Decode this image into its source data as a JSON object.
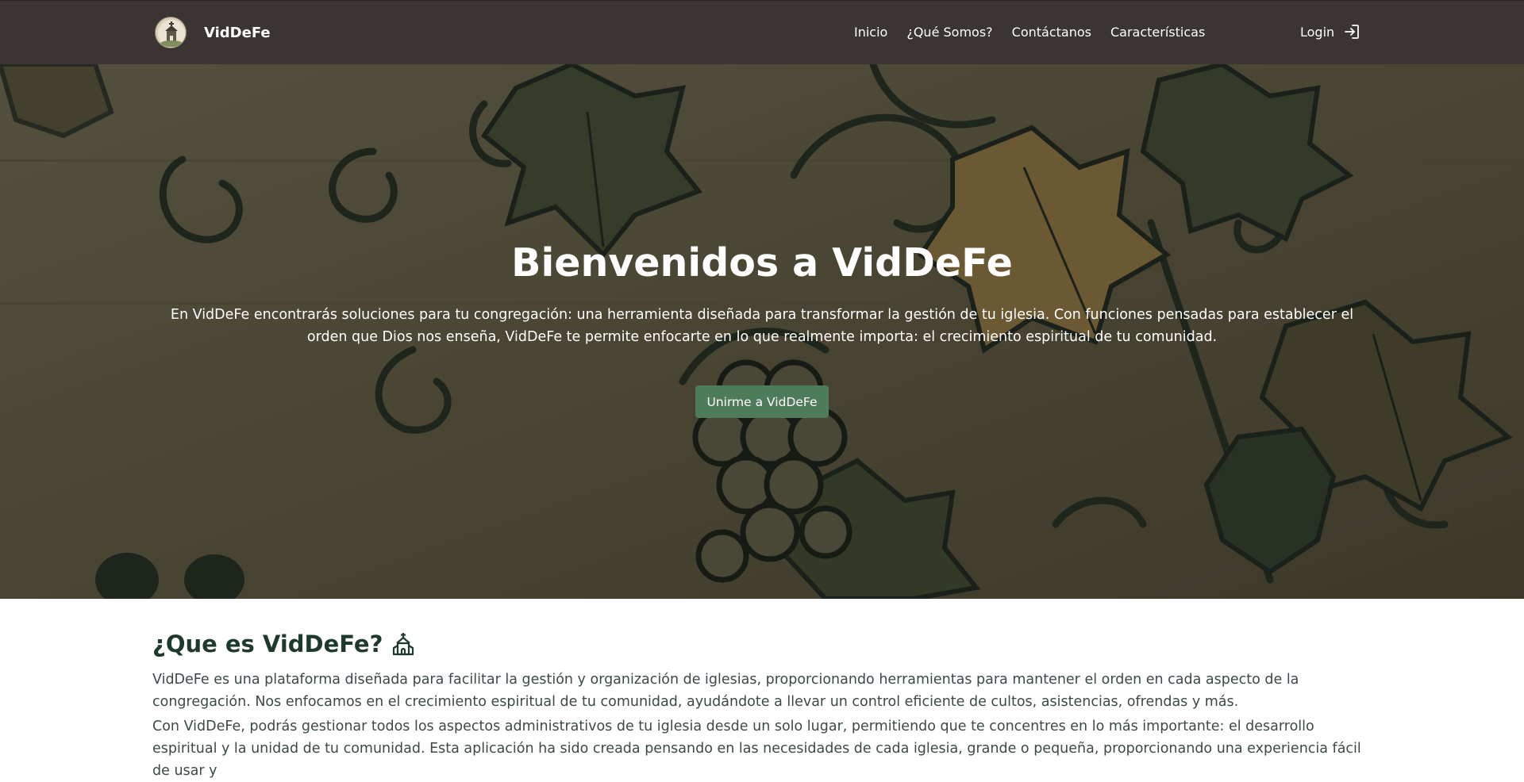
{
  "brand": {
    "name": "VidDeFe",
    "logo_icon": "church-logo-icon"
  },
  "nav": {
    "links": [
      {
        "label": "Inicio"
      },
      {
        "label": "¿Qué Somos?"
      },
      {
        "label": "Contáctanos"
      },
      {
        "label": "Características"
      }
    ],
    "login_label": "Login",
    "login_icon": "login-arrow-icon"
  },
  "hero": {
    "title": "Bienvenidos a VidDeFe",
    "description": "En VidDeFe encontrarás soluciones para tu congregación: una herramienta diseñada para transformar la gestión de tu iglesia. Con funciones pensadas para establecer el orden que Dios nos enseña, VidDeFe te permite enfocarte en lo que realmente importa: el crecimiento espiritual de tu comunidad.",
    "cta_label": "Unirme a VidDeFe",
    "background": "grapevine-illustration"
  },
  "about": {
    "title": "¿Que es VidDeFe?",
    "title_icon": "church-icon",
    "paragraph_1": "VidDeFe es una plataforma diseñada para facilitar la gestión y organización de iglesias, proporcionando herramientas para mantener el orden en cada aspecto de la congregación. Nos enfocamos en el crecimiento espiritual de tu comunidad, ayudándote a llevar un control eficiente de cultos, asistencias, ofrendas y más.",
    "paragraph_2": "Con VidDeFe, podrás gestionar todos los aspectos administrativos de tu iglesia desde un solo lugar, permitiendo que te concentres en lo más importante: el desarrollo espiritual y la unidad de tu comunidad. Esta aplicación ha sido creada pensando en las necesidades de cada iglesia, grande o pequeña, proporcionando una experiencia fácil de usar y"
  },
  "colors": {
    "navbar": "#3a3432",
    "accent_button": "#4e7b59",
    "heading": "#1d3a2a",
    "body_text": "#3b4a46"
  }
}
